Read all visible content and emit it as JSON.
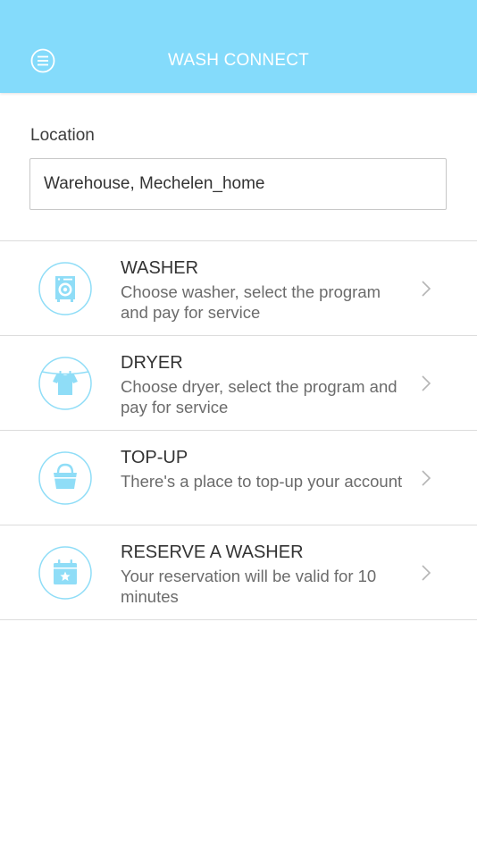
{
  "header": {
    "title": "WASH CONNECT",
    "menu_icon": "hamburger-menu-icon",
    "background_color": "#84DBFB"
  },
  "location": {
    "label": "Location",
    "value": "Warehouse, Mechelen_home"
  },
  "menu": {
    "items": [
      {
        "title": "WASHER",
        "description": "Choose washer, select the program and pay for service",
        "icon": "washing-machine-icon"
      },
      {
        "title": "DRYER",
        "description": "Choose dryer, select the program and pay for service",
        "icon": "shirt-on-line-icon"
      },
      {
        "title": "TOP-UP",
        "description": "There's a place to top-up your account",
        "icon": "bag-icon"
      },
      {
        "title": "RESERVE A WASHER",
        "description": "Your reservation will be valid for 10 minutes",
        "icon": "calendar-star-icon"
      }
    ]
  },
  "colors": {
    "accent": "#84DBFB",
    "icon_stroke": "#8FDDF7",
    "divider": "#dcdcdc"
  }
}
